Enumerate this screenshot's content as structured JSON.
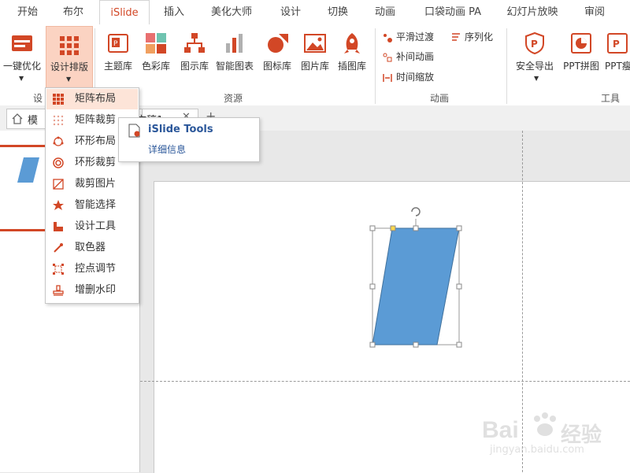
{
  "ribbon_tabs": [
    "开始",
    "布尔",
    "iSlide",
    "插入",
    "美化大师",
    "设计",
    "切换",
    "动画",
    "口袋动画 PA",
    "幻灯片放映",
    "审阅"
  ],
  "active_tab": "iSlide",
  "ribbon": {
    "buttons": {
      "one_key": "一键优化",
      "design_layout": "设计排版",
      "theme_lib": "主题库",
      "color_lib": "色彩库",
      "diagram_lib": "图示库",
      "smart_chart": "智能图表",
      "icon_lib": "图标库",
      "picture_lib": "图片库",
      "illus_lib": "插图库",
      "safe_export": "安全导出",
      "ppt_collage": "PPT拼图",
      "ppt_more": "PPT瘦"
    },
    "anim": {
      "smooth": "平滑过渡",
      "tween": "补间动画",
      "time_scale": "时间缩放",
      "sequence": "序列化"
    },
    "groups": {
      "design_partial": "设",
      "resources": "资源",
      "animation": "动画",
      "tools": "工具"
    }
  },
  "dropdown": {
    "items": [
      {
        "label": "矩阵布局",
        "icon": "matrix-layout-icon"
      },
      {
        "label": "矩阵裁剪",
        "icon": "matrix-crop-icon"
      },
      {
        "label": "环形布局",
        "icon": "ring-layout-icon"
      },
      {
        "label": "环形裁剪",
        "icon": "ring-crop-icon"
      },
      {
        "label": "裁剪图片",
        "icon": "crop-picture-icon"
      },
      {
        "label": "智能选择",
        "icon": "smart-select-icon"
      },
      {
        "label": "设计工具",
        "icon": "design-tools-icon"
      },
      {
        "label": "取色器",
        "icon": "color-picker-icon"
      },
      {
        "label": "控点调节",
        "icon": "handle-adjust-icon"
      },
      {
        "label": "增删水印",
        "icon": "watermark-icon"
      }
    ],
    "highlighted": "矩阵布局"
  },
  "tooltip": {
    "title": "iSlide Tools",
    "link": "详细信息"
  },
  "docbar": {
    "home_label": "模",
    "doc_label": "文稿1"
  },
  "watermark": {
    "brand": "Bai",
    "brand2": "经验",
    "url": "jingyan.baidu.com"
  },
  "colors": {
    "accent": "#d24726",
    "shape_fill": "#5b9bd5",
    "menu_highlight": "#fde4d8"
  }
}
